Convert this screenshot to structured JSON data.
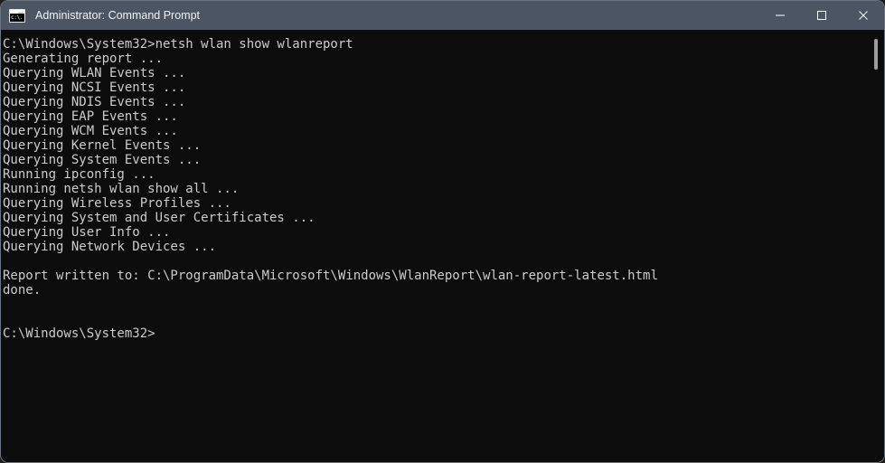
{
  "window": {
    "title": "Administrator: Command Prompt",
    "icon": "command-prompt-icon",
    "icon_glyph": "c:\\.",
    "background_color": "#0c0c0c",
    "titlebar_color": "#4c5563",
    "text_color": "#cccccc"
  },
  "controls": {
    "minimize_label": "Minimize",
    "maximize_label": "Maximize",
    "close_label": "Close"
  },
  "console": {
    "lines": [
      "C:\\Windows\\System32>netsh wlan show wlanreport",
      "Generating report ...",
      "Querying WLAN Events ...",
      "Querying NCSI Events ...",
      "Querying NDIS Events ...",
      "Querying EAP Events ...",
      "Querying WCM Events ...",
      "Querying Kernel Events ...",
      "Querying System Events ...",
      "Running ipconfig ...",
      "Running netsh wlan show all ...",
      "Querying Wireless Profiles ...",
      "Querying System and User Certificates ...",
      "Querying User Info ...",
      "Querying Network Devices ...",
      "",
      "Report written to: C:\\ProgramData\\Microsoft\\Windows\\WlanReport\\wlan-report-latest.html",
      "done.",
      "",
      "",
      "C:\\Windows\\System32>"
    ],
    "text": "C:\\Windows\\System32>netsh wlan show wlanreport\nGenerating report ...\nQuerying WLAN Events ...\nQuerying NCSI Events ...\nQuerying NDIS Events ...\nQuerying EAP Events ...\nQuerying WCM Events ...\nQuerying Kernel Events ...\nQuerying System Events ...\nRunning ipconfig ...\nRunning netsh wlan show all ...\nQuerying Wireless Profiles ...\nQuerying System and User Certificates ...\nQuerying User Info ...\nQuerying Network Devices ...\n\nReport written to: C:\\ProgramData\\Microsoft\\Windows\\WlanReport\\wlan-report-latest.html\ndone.\n\n\nC:\\Windows\\System32>",
    "command": "netsh wlan show wlanreport",
    "prompt": "C:\\Windows\\System32>",
    "report_path": "C:\\ProgramData\\Microsoft\\Windows\\WlanReport\\wlan-report-latest.html"
  }
}
